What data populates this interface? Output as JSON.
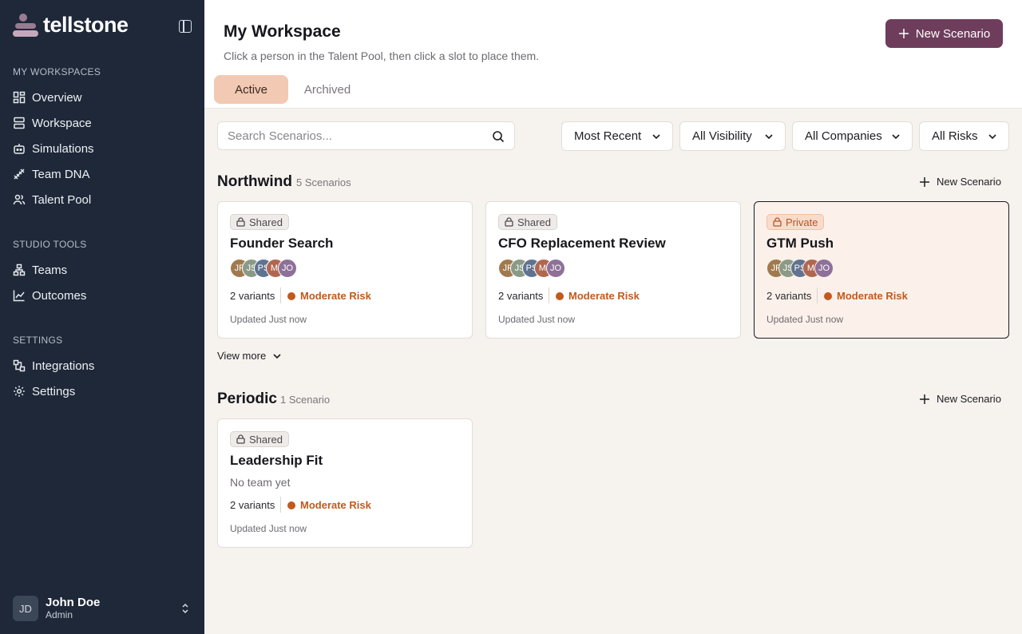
{
  "brand": {
    "name": "tellstone"
  },
  "sidebar": {
    "sections": [
      {
        "label": "MY WORKSPACES",
        "items": [
          {
            "label": "Overview",
            "icon": "grid-icon"
          },
          {
            "label": "Workspace",
            "icon": "stack-icon"
          },
          {
            "label": "Simulations",
            "icon": "robot-icon"
          },
          {
            "label": "Team DNA",
            "icon": "dna-icon"
          },
          {
            "label": "Talent Pool",
            "icon": "people-icon"
          }
        ]
      },
      {
        "label": "STUDIO TOOLS",
        "items": [
          {
            "label": "Teams",
            "icon": "org-chart-icon"
          },
          {
            "label": "Outcomes",
            "icon": "line-chart-icon"
          }
        ]
      },
      {
        "label": "SETTINGS",
        "items": [
          {
            "label": "Integrations",
            "icon": "integrations-icon"
          },
          {
            "label": "Settings",
            "icon": "gear-icon"
          }
        ]
      }
    ],
    "user": {
      "initials": "JD",
      "name": "John Doe",
      "role": "Admin"
    }
  },
  "header": {
    "title": "My Workspace",
    "subtitle": "Click a person in the Talent Pool, then click a slot to place them.",
    "new_scenario_label": "New Scenario",
    "tabs": [
      {
        "label": "Active"
      },
      {
        "label": "Archived"
      }
    ]
  },
  "filters": {
    "search_placeholder": "Search Scenarios...",
    "sort": "Most Recent",
    "visibility": "All Visibility",
    "companies": "All Companies",
    "risks": "All Risks"
  },
  "colors": {
    "accent": "#6e3d5c",
    "sidebar": "#1e2838",
    "risk": "#c25a1c",
    "active_tab": "#f2c9b3"
  },
  "groups": [
    {
      "name": "Northwind",
      "count": "5 Scenarios",
      "new_label": "New Scenario",
      "view_more": "View more",
      "cards": [
        {
          "visibility": "Shared",
          "title": "Founder Search",
          "variants": "2 variants",
          "risk": "Moderate Risk",
          "updated": "Updated Just now",
          "avatars": [
            "JP",
            "JS",
            "PS",
            "MI",
            "JO"
          ]
        },
        {
          "visibility": "Shared",
          "title": "CFO Replacement Review",
          "variants": "2 variants",
          "risk": "Moderate Risk",
          "updated": "Updated Just now",
          "avatars": [
            "JP",
            "JS",
            "PS",
            "MI",
            "JO"
          ]
        },
        {
          "visibility": "Private",
          "title": "GTM Push",
          "variants": "2 variants",
          "risk": "Moderate Risk",
          "updated": "Updated Just now",
          "avatars": [
            "JP",
            "JS",
            "PS",
            "MI",
            "JO"
          ]
        }
      ]
    },
    {
      "name": "Periodic",
      "count": "1 Scenario",
      "new_label": "New Scenario",
      "cards": [
        {
          "visibility": "Shared",
          "title": "Leadership Fit",
          "team_text": "No team yet",
          "variants": "2 variants",
          "risk": "Moderate Risk",
          "updated": "Updated Just now"
        }
      ]
    }
  ]
}
